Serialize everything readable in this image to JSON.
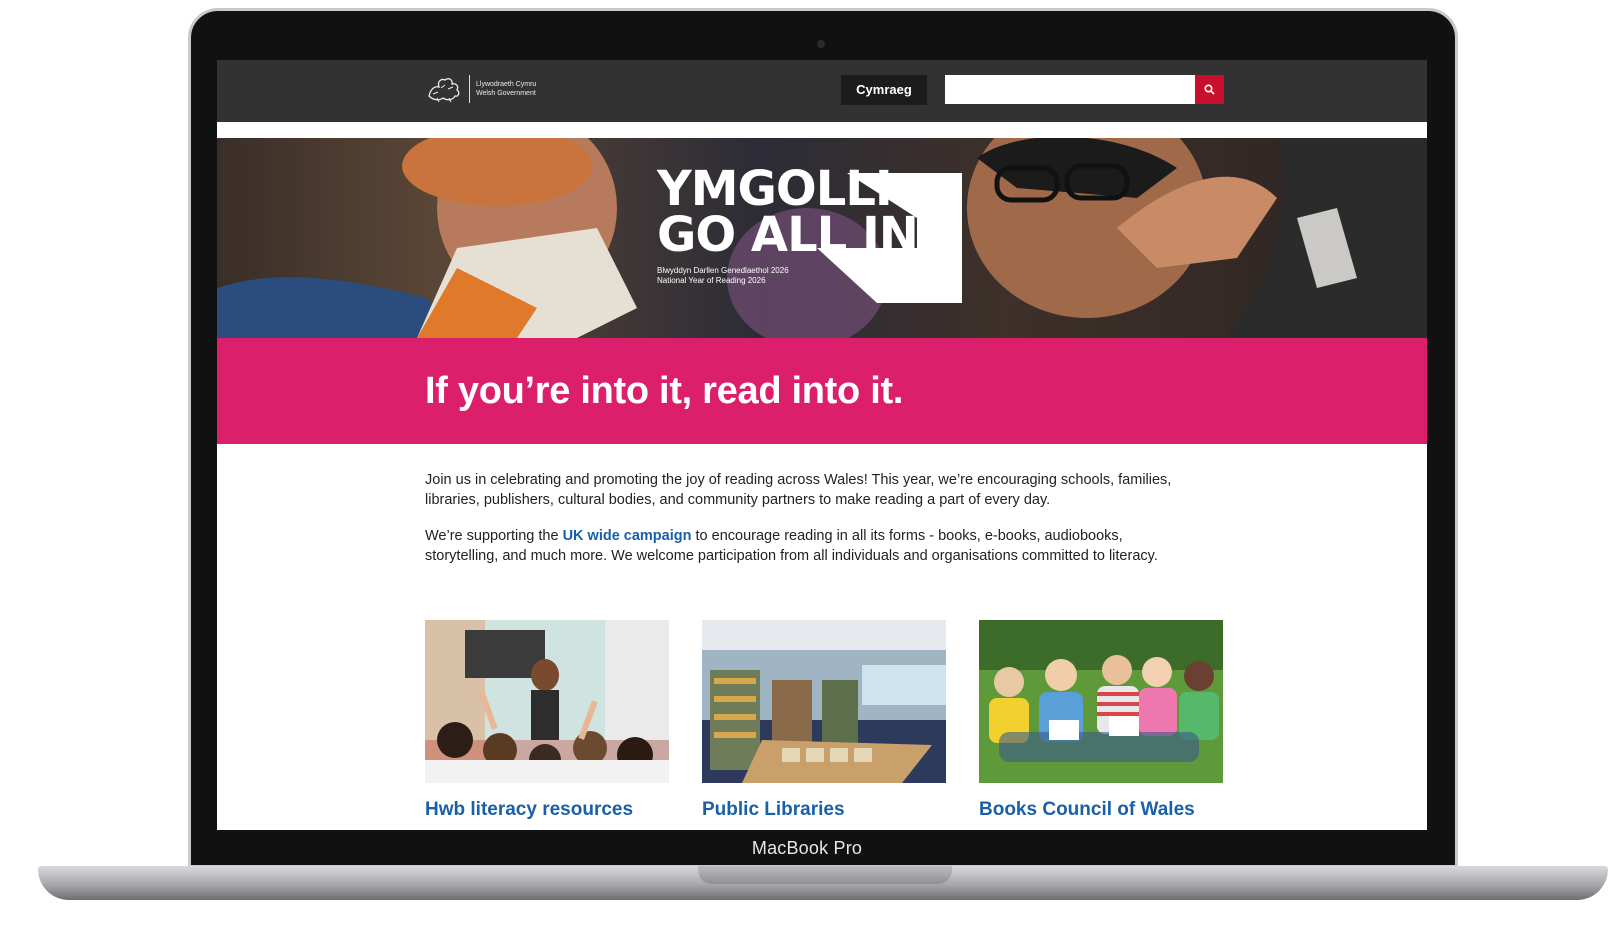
{
  "device": {
    "label": "MacBook Pro"
  },
  "header": {
    "logo_line1": "Llywodraeth Cymru",
    "logo_line2": "Welsh Government",
    "language_button": "Cymraeg",
    "search_placeholder": ""
  },
  "hero": {
    "title_line1": "YMGOLLI.",
    "title_line2": "GO ALL IN.",
    "subtitle_line1": "Blwyddyn Darllen Genedlaethol 2026",
    "subtitle_line2": "National Year of Reading 2026"
  },
  "band": {
    "heading": "If you’re into it, read into it."
  },
  "intro": {
    "paragraph1": "Join us in celebrating and promoting the joy of reading across Wales! This year, we’re encouraging schools, families, libraries, publishers, cultural bodies, and community partners to make reading a part of every day.",
    "p2_before": "We’re supporting the ",
    "p2_link": "UK wide campaign",
    "p2_after": " to encourage reading in all its forms - books, e-books, audiobooks, storytelling, and much more. We welcome participation from all individuals and organisations committed to literacy."
  },
  "cards": [
    {
      "title": "Hwb literacy resources"
    },
    {
      "title": "Public Libraries"
    },
    {
      "title": "Books Council of Wales"
    }
  ],
  "colors": {
    "pink": "#db1f6b",
    "link": "#1a5fa8",
    "search_red": "#c8102e",
    "header": "#323232"
  }
}
